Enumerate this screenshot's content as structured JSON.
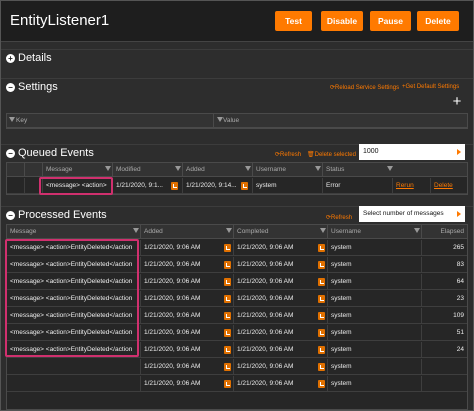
{
  "window": {
    "title": "EntityListener1"
  },
  "toolbar": {
    "test": "Test",
    "disable": "Disable",
    "pause": "Pause",
    "delete": "Delete"
  },
  "sections": {
    "details": {
      "title": "Details",
      "toggle": "+"
    },
    "settings": {
      "title": "Settings",
      "toggle": "−",
      "reload": "Reload Service Settings",
      "get_default": "Get Default Settings",
      "add_label": "+",
      "columns": [
        "Key",
        "Value"
      ]
    },
    "queued": {
      "title": "Queued Events",
      "toggle": "−",
      "refresh": "Refresh",
      "delete_selected": "Delete selected",
      "count_value": "1000",
      "columns": [
        "Message",
        "Modified",
        "Added",
        "Username",
        "Status"
      ],
      "rows": [
        {
          "message": "<message> <action>",
          "modified": "1/21/2020, 9:1...",
          "added": "1/21/2020, 9:14...",
          "username": "system",
          "status": "Error",
          "rerun": "Rerun",
          "delete": "Delete"
        }
      ]
    },
    "processed": {
      "title": "Processed Events",
      "toggle": "−",
      "refresh": "Refresh",
      "select_placeholder": "Select number of messages",
      "columns": [
        "Message",
        "Added",
        "Completed",
        "Username",
        "Elapsed"
      ],
      "rows": [
        {
          "message": "<message> <action>EntityDeleted</action",
          "added": "1/21/2020, 9:06 AM",
          "completed": "1/21/2020, 9:06 AM",
          "username": "system",
          "elapsed": "265"
        },
        {
          "message": "<message> <action>EntityDeleted</action",
          "added": "1/21/2020, 9:06 AM",
          "completed": "1/21/2020, 9:06 AM",
          "username": "system",
          "elapsed": "83"
        },
        {
          "message": "<message> <action>EntityDeleted</action",
          "added": "1/21/2020, 9:06 AM",
          "completed": "1/21/2020, 9:06 AM",
          "username": "system",
          "elapsed": "64"
        },
        {
          "message": "<message> <action>EntityDeleted</action",
          "added": "1/21/2020, 9:06 AM",
          "completed": "1/21/2020, 9:06 AM",
          "username": "system",
          "elapsed": "23"
        },
        {
          "message": "<message> <action>EntityDeleted</action",
          "added": "1/21/2020, 9:06 AM",
          "completed": "1/21/2020, 9:06 AM",
          "username": "system",
          "elapsed": "109"
        },
        {
          "message": "<message> <action>EntityDeleted</action",
          "added": "1/21/2020, 9:06 AM",
          "completed": "1/21/2020, 9:06 AM",
          "username": "system",
          "elapsed": "51"
        },
        {
          "message": "<message> <action>EntityDeleted</action",
          "added": "1/21/2020, 9:06 AM",
          "completed": "1/21/2020, 9:06 AM",
          "username": "system",
          "elapsed": "24"
        },
        {
          "message": "",
          "added": "1/21/2020, 9:06 AM",
          "completed": "1/21/2020, 9:06 AM",
          "username": "system",
          "elapsed": ""
        },
        {
          "message": "",
          "added": "1/21/2020, 9:06 AM",
          "completed": "1/21/2020, 9:06 AM",
          "username": "system",
          "elapsed": ""
        }
      ]
    }
  },
  "colors": {
    "accent": "#ff7a00",
    "highlight": "#d0306e",
    "background": "#2d2d2d"
  },
  "icons": [
    "refresh-icon",
    "delete-icon",
    "settings-icon",
    "plus-icon",
    "filter-icon",
    "document-icon",
    "caret-right-icon"
  ]
}
